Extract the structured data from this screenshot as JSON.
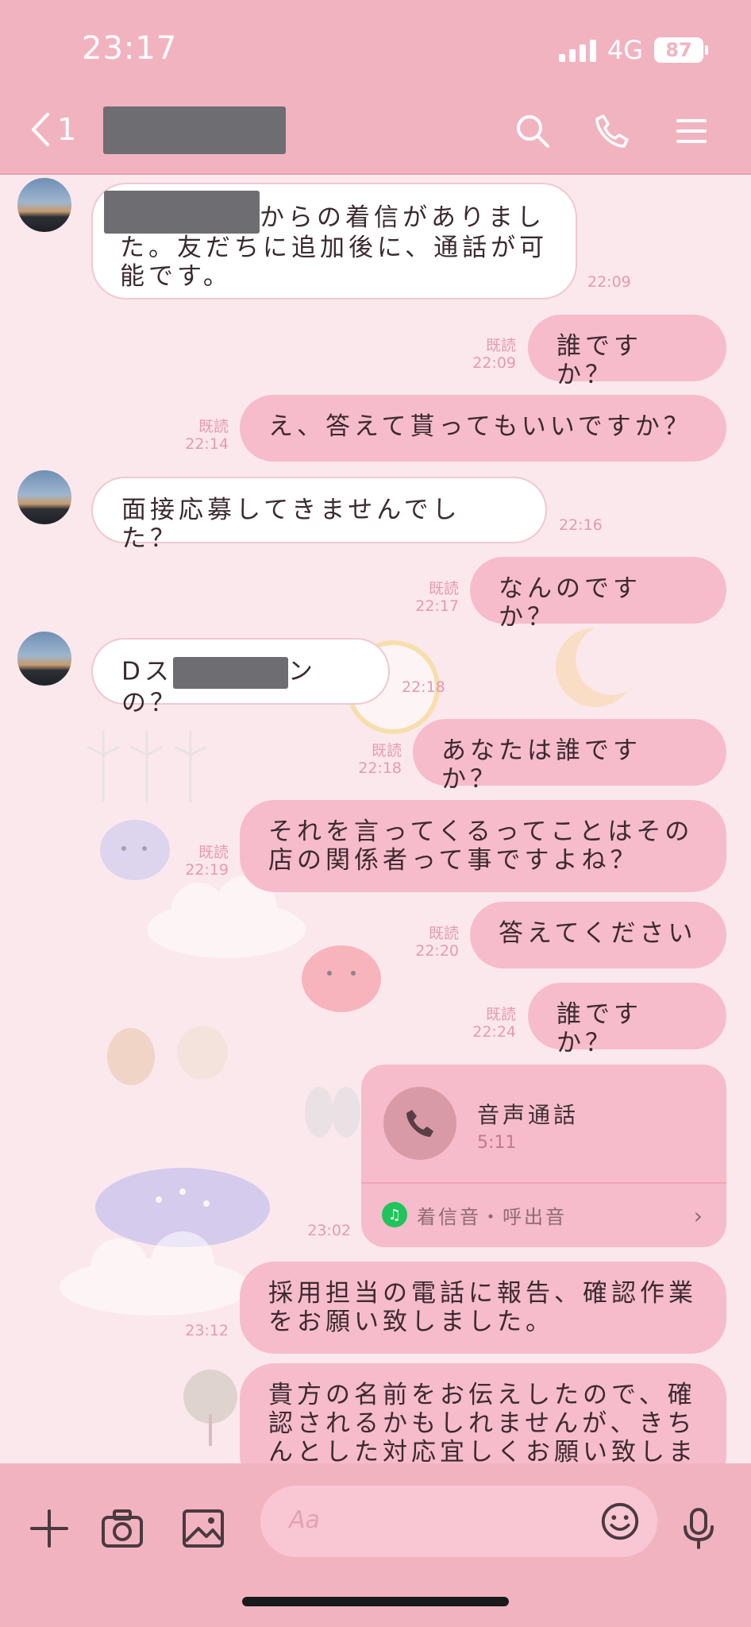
{
  "status_bar": {
    "time": "23:17",
    "network": "4G",
    "battery": "87"
  },
  "header": {
    "back_count": "1"
  },
  "messages": [
    {
      "dir": "in",
      "text_after_redact": "からの着信がありました。友だちに追加後に、通話が可能です。",
      "time": "22:09"
    },
    {
      "dir": "out",
      "text": "誰ですか？",
      "read": "既読",
      "time": "22:09"
    },
    {
      "dir": "out",
      "text": "え、答えて貰ってもいいですか？",
      "read": "既読",
      "time": "22:14"
    },
    {
      "dir": "in",
      "text": "面接応募してきませんでした？",
      "time": "22:16"
    },
    {
      "dir": "out",
      "text": "なんのですか？",
      "read": "既読",
      "time": "22:17"
    },
    {
      "dir": "in",
      "text_before_redact": "Dス",
      "text_after_redact": "ンの？",
      "time": "22:18"
    },
    {
      "dir": "out",
      "text": "あなたは誰ですか？",
      "read": "既読",
      "time": "22:18"
    },
    {
      "dir": "out",
      "text": "それを言ってくるってことはその店の関係者って事ですよね？",
      "read": "既読",
      "time": "22:19"
    },
    {
      "dir": "out",
      "text": "答えてください",
      "read": "既読",
      "time": "22:20"
    },
    {
      "dir": "out",
      "text": "誰ですか？",
      "read": "既読",
      "time": "22:24"
    },
    {
      "dir": "out",
      "text": "採用担当の電話に報告、確認作業をお願い致しました。",
      "time": "23:12"
    },
    {
      "dir": "out",
      "text": "貴方の名前をお伝えしたので、確認されるかもしれませんが、きちんとした対応宜しくお願い致しま"
    }
  ],
  "call_card": {
    "title": "音声通話",
    "duration": "5:11",
    "ringtone_label": "着信音・呼出音",
    "time": "23:02"
  },
  "composer": {
    "placeholder": "Aa"
  },
  "colors": {
    "header": "#f2b3c1",
    "outgoing_bubble": "#f6bccb",
    "incoming_bubble": "#ffffff",
    "meta_text": "#e69aad"
  }
}
